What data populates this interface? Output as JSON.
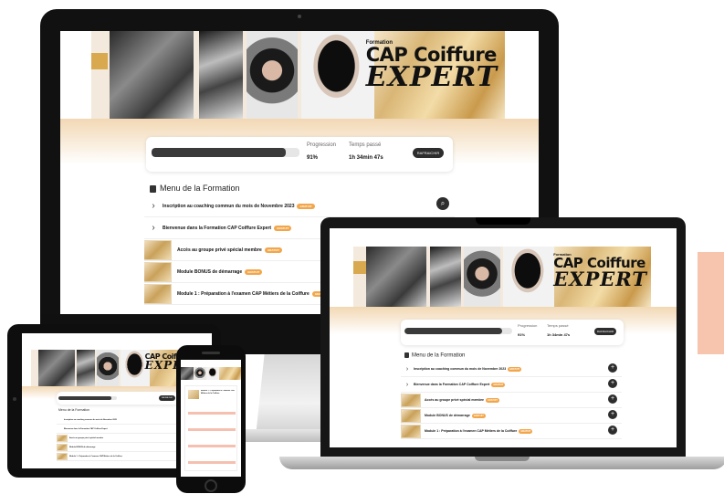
{
  "brand": {
    "pre": "Formation",
    "cap": "CAP Coiffure",
    "expert": "EXPERT"
  },
  "progress": {
    "label": "Progression",
    "value": "91%",
    "fraction": 0.91,
    "time_label": "Temps passé",
    "time_value": "1h 34min 47s",
    "button": "RAFRAICHIR"
  },
  "menu": {
    "title": "Menu de la Formation",
    "items": [
      {
        "title": "Inscription au coaching commun du mois de Novembre 2023",
        "badge": "GRATUIT",
        "has_thumb": false
      },
      {
        "title": "Bienvenue dans la Formation CAP Coiffure Expert",
        "badge": "GRATUIT",
        "has_thumb": false
      },
      {
        "title": "Accès au groupe privé spécial membre",
        "badge": "GRATUIT",
        "has_thumb": true
      },
      {
        "title": "Module BONUS de démarrage",
        "badge": "GRATUIT",
        "has_thumb": true
      },
      {
        "title": "Module 1 : Préparation à l'examen CAP Métiers de la Coiffure",
        "badge": "GRATUIT",
        "has_thumb": true
      }
    ]
  },
  "icons": {
    "chevron": "›",
    "plus": "+",
    "search": "⌕"
  },
  "colors": {
    "accent_gold": "#d8a94e",
    "badge_orange": "#f2a64b",
    "dark_button": "#2d2d2d",
    "peach": "#f7c4ae"
  }
}
